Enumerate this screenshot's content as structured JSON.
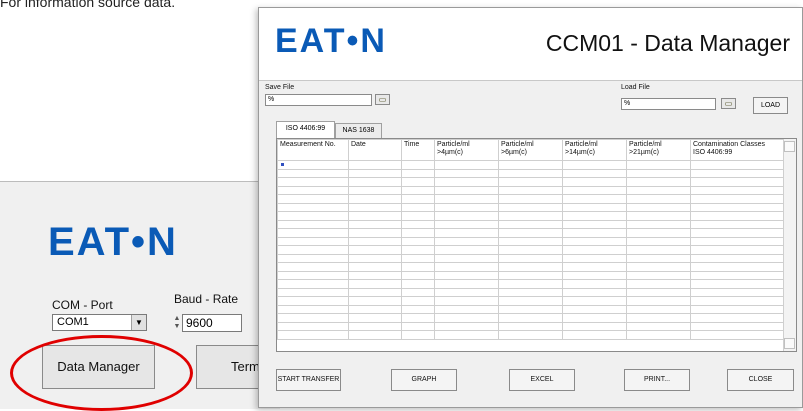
{
  "caption": "For information source data.",
  "main_window": {
    "logo_text": "EAT•N",
    "com_port_label": "COM - Port",
    "com_port_value": "COM1",
    "baud_rate_label": "Baud - Rate",
    "baud_rate_value": "9600",
    "data_manager_button": "Data Manager",
    "terminal_button": "Term"
  },
  "data_manager_window": {
    "logo_text": "EAT•N",
    "title": "CCM01 - Data Manager",
    "save_file": {
      "label": "Save File",
      "value": "%"
    },
    "load_file": {
      "label": "Load File",
      "value": "%"
    },
    "load_button": "LOAD",
    "tabs": [
      {
        "label": "ISO 4406:99",
        "active": true
      },
      {
        "label": "NAS 1638",
        "active": false
      }
    ],
    "table": {
      "columns": [
        [
          "Measurement No.",
          ""
        ],
        [
          "Date",
          ""
        ],
        [
          "Time",
          ""
        ],
        [
          "Particle/ml",
          ">4µm(c)"
        ],
        [
          "Particle/ml",
          ">6µm(c)"
        ],
        [
          "Particle/ml",
          ">14µm(c)"
        ],
        [
          "Particle/ml",
          ">21µm(c)"
        ],
        [
          "Contamination Classes",
          "ISO 4406:99"
        ]
      ],
      "empty_row_count": 21
    },
    "footer_buttons": {
      "start_transfer": "START TRANSFER",
      "graph": "GRAPH",
      "excel": "EXCEL",
      "print": "PRINT...",
      "close": "CLOSE"
    }
  },
  "colors": {
    "eaton_blue": "#0a5ab6",
    "highlight_circle": "#e00000"
  }
}
